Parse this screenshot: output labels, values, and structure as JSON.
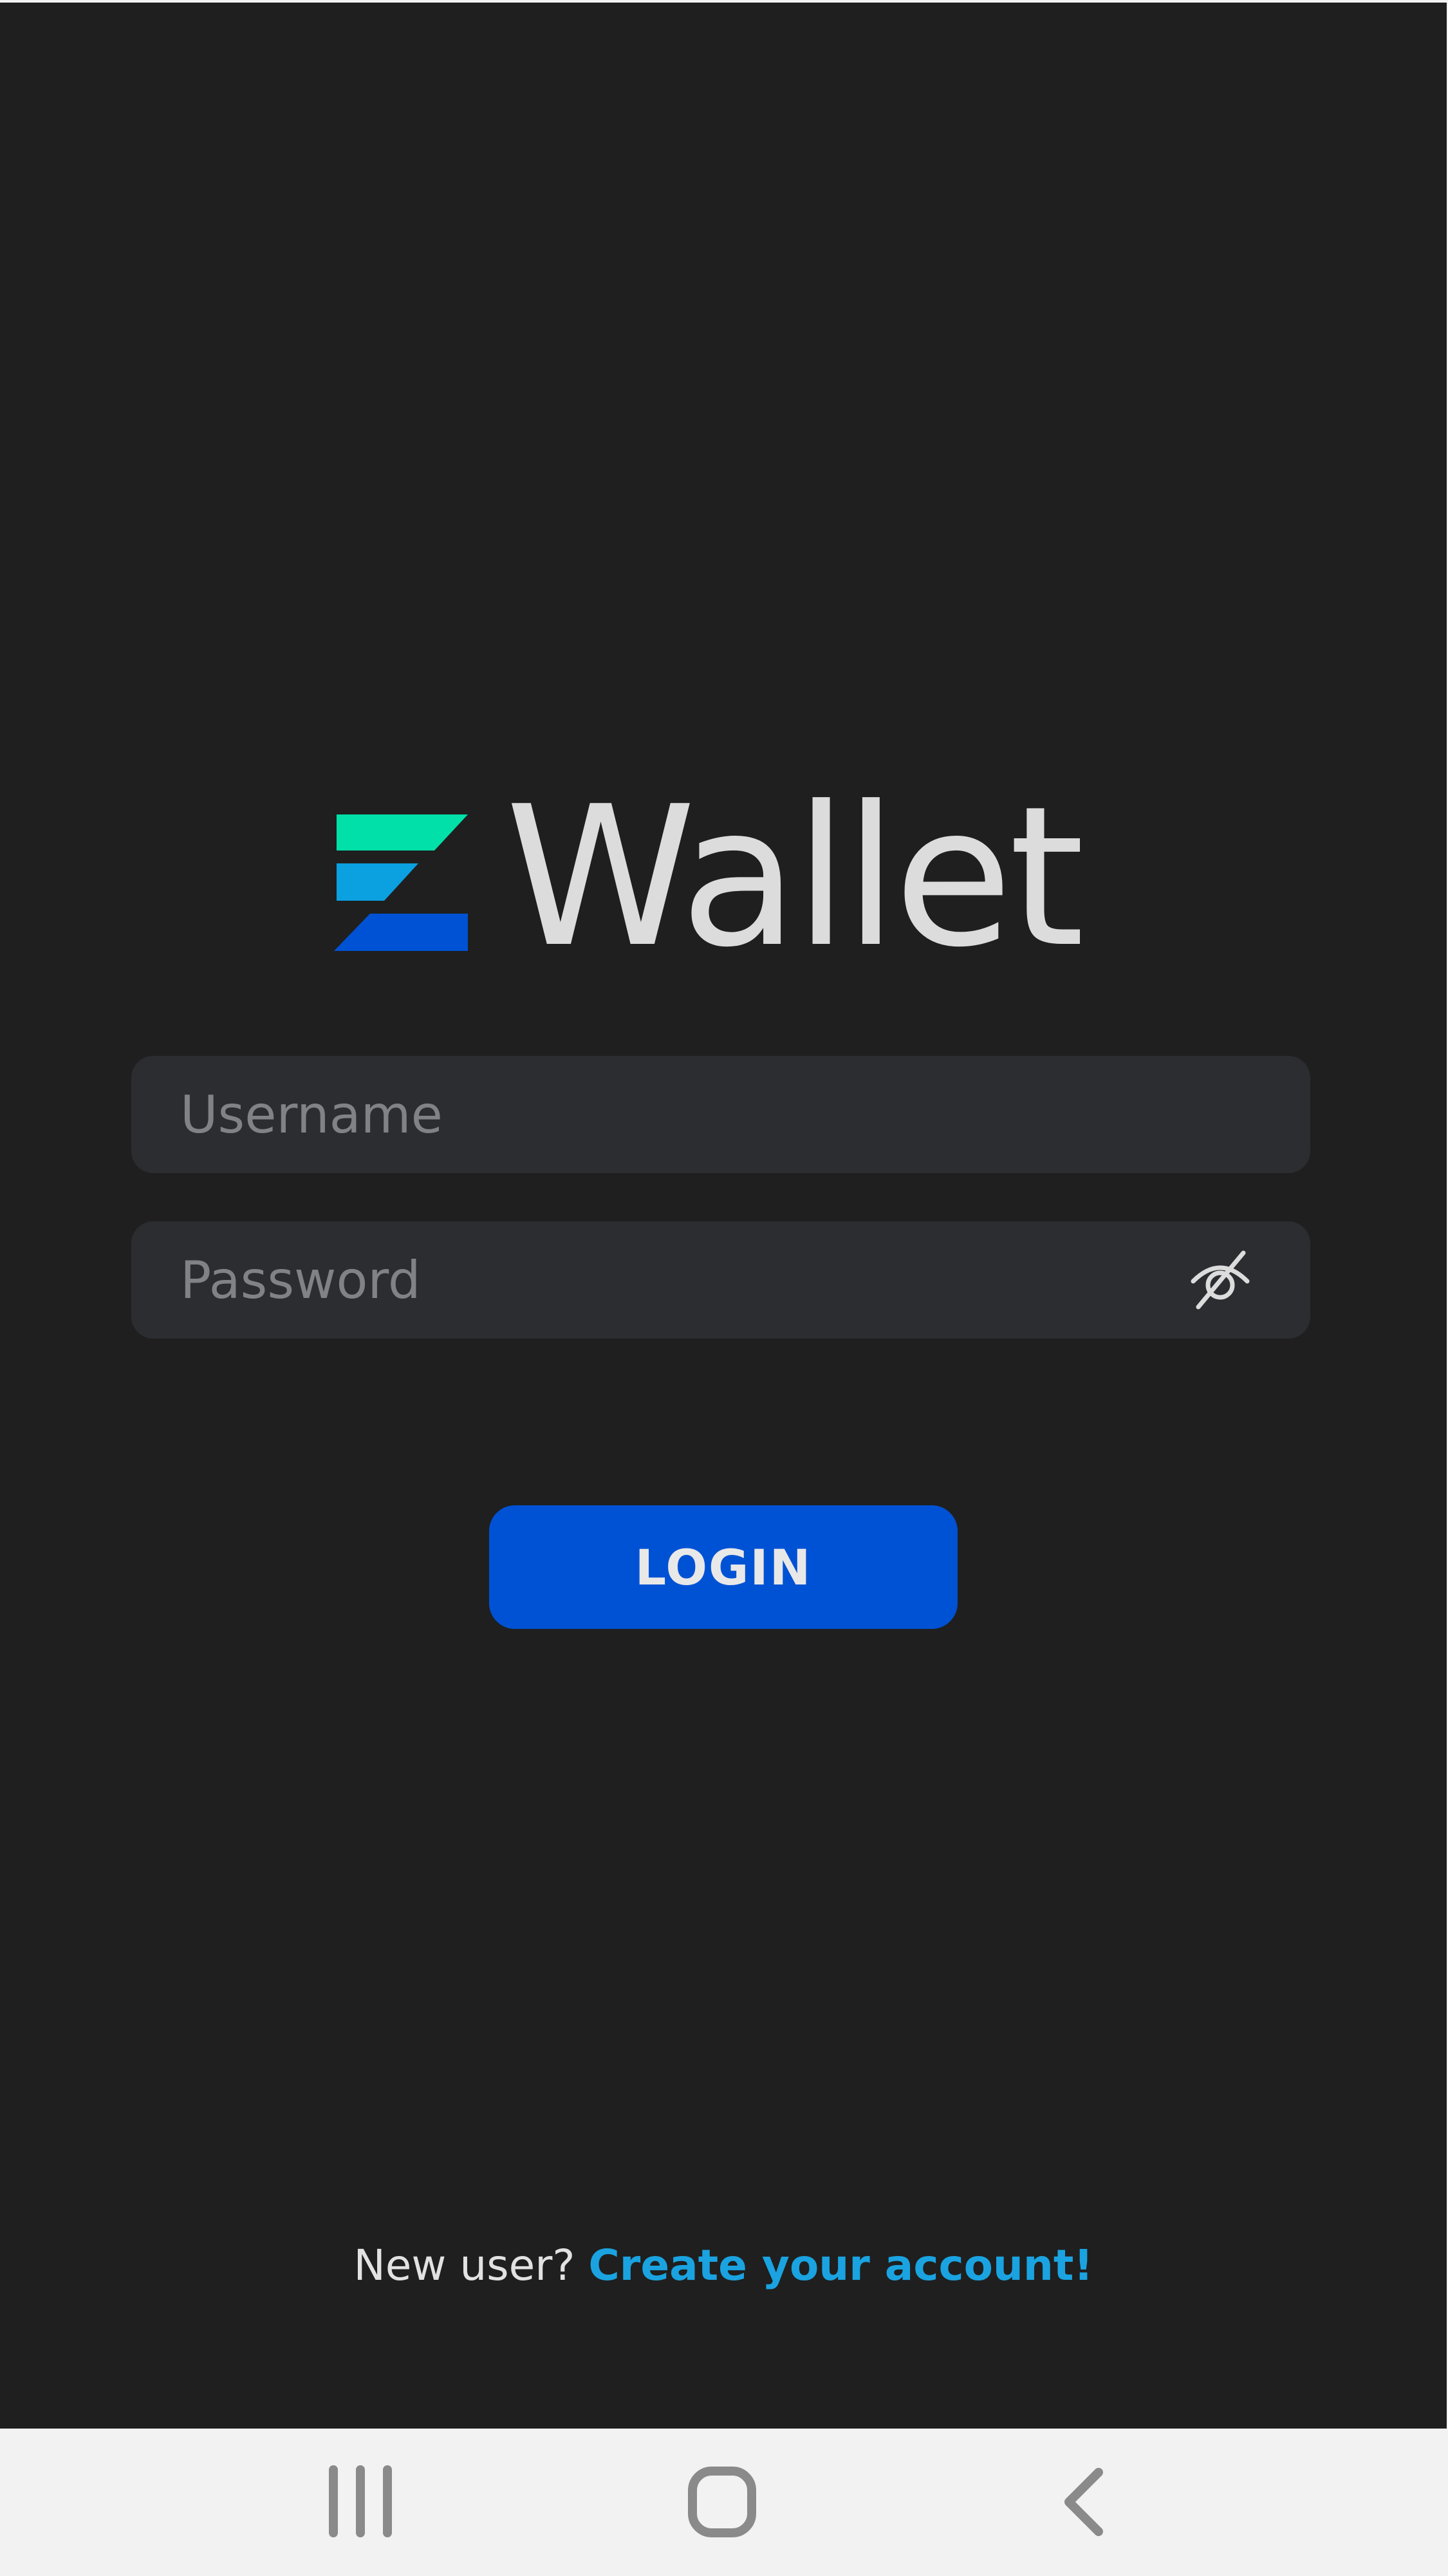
{
  "app": {
    "logo_text": "Wallet",
    "colors": {
      "background": "#1f1f1f",
      "field": "#2c2d31",
      "primary": "#0052d4",
      "link": "#1aa3e0",
      "logo_teal": "#00e0a8",
      "logo_cyan": "#0ba0e0",
      "logo_blue": "#0052d4"
    }
  },
  "form": {
    "username": {
      "placeholder": "Username",
      "value": ""
    },
    "password": {
      "placeholder": "Password",
      "value": "",
      "toggle_icon": "eye-off-icon"
    },
    "login_label": "LOGIN"
  },
  "signup": {
    "prompt": "New user?",
    "link_label": "Create your account!"
  },
  "navbar": {
    "recents_icon": "recent-apps-icon",
    "home_icon": "home-icon",
    "back_icon": "back-icon"
  }
}
